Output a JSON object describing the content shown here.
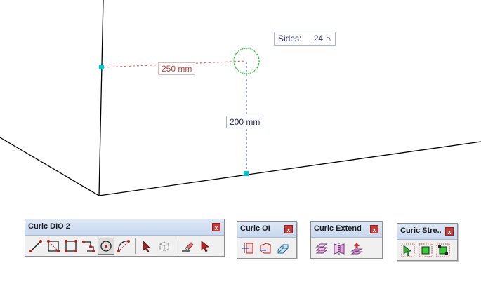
{
  "dimensions": {
    "horizontal": "250 mm",
    "vertical": "200 mm"
  },
  "sides_input": {
    "label": "Sides:",
    "value": "24 ∩"
  },
  "colors": {
    "edge": "#000000",
    "endpoint": "#00c8d0",
    "circle": "#2ec42e",
    "dim_red": "#e05050",
    "dim_blue": "#3050c0"
  },
  "toolbars": [
    {
      "title": "Curic DIO 2",
      "close": "x",
      "tools": [
        "line-icon",
        "rectangle-diagonal-icon",
        "rectangle-icon",
        "rotated-rectangle-icon",
        "circle-icon",
        "arc-icon",
        "select-arrow-icon",
        "component-box-icon",
        "eraser-icon",
        "pointer-icon"
      ]
    },
    {
      "title": "Curic OI",
      "close": "x",
      "tools": [
        "offset-edge-icon",
        "offset-face-icon",
        "extrude-face-icon"
      ]
    },
    {
      "title": "Curic Extend",
      "close": "x",
      "tools": [
        "extend-layers-icon",
        "extend-mirror-icon",
        "extend-stamp-icon"
      ]
    },
    {
      "title": "Curic Stre...",
      "close": "x",
      "tools": [
        "stretch-select-icon",
        "stretch-box-icon",
        "stretch-box-corner-icon"
      ]
    }
  ]
}
